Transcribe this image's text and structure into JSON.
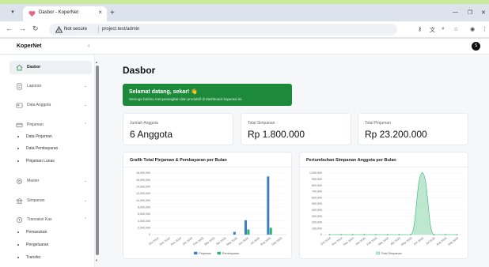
{
  "browser": {
    "tab_title": "Dasbor - KoperNet",
    "new_tab": "+",
    "not_secure": "Not secure",
    "url": "project.test/admin"
  },
  "app": {
    "brand": "KoperNet",
    "avatar_initial": "S",
    "page_title": "Dasbor"
  },
  "sidebar": {
    "items": [
      {
        "label": "Dasbor",
        "icon": "home-icon",
        "active": true
      },
      {
        "label": "Laporan",
        "icon": "report-icon"
      },
      {
        "label": "Data Anggota",
        "icon": "users-icon"
      },
      {
        "label": "Pinjaman",
        "icon": "loan-icon"
      },
      {
        "label": "Master",
        "icon": "settings-icon"
      },
      {
        "label": "Simpanan",
        "icon": "savings-icon"
      },
      {
        "label": "Transaksi Kas",
        "icon": "cash-icon"
      }
    ],
    "pinjaman_sub": [
      "Data Pinjaman",
      "Data Pembayaran",
      "Pinjaman Lunas"
    ],
    "kas_sub": [
      "Pemasukan",
      "Pengeluaran",
      "Transfer"
    ]
  },
  "welcome": {
    "title": "Selamat datang, sekar! 👋",
    "subtitle": "Semoga harimu menyenangkan dan produktif di dashboard koperasi ini."
  },
  "stats": [
    {
      "label": "Jumlah Anggota",
      "value": "6 Anggota"
    },
    {
      "label": "Total Simpanan",
      "value": "Rp 1.800.000"
    },
    {
      "label": "Total Pinjaman",
      "value": "Rp 23.200.000"
    }
  ],
  "colors": {
    "brand_green": "#1c8a3a",
    "pinjaman": "#3b7fc4",
    "pembayaran": "#2bb673",
    "simpanan": "#2bb673"
  },
  "chart_data": [
    {
      "type": "bar",
      "title": "Grafik Total Pinjaman & Pembayaran per Bulan",
      "categories": [
        "Oct 2024",
        "Nov 2024",
        "Dec 2024",
        "Jan 2025",
        "Feb 2025",
        "Mar 2025",
        "Apr 2025",
        "May 2025",
        "Jun 2025",
        "Jul 2025",
        "Aug 2025",
        "Sep 2025"
      ],
      "yticks": [
        "0",
        "2,000,000",
        "4,000,000",
        "6,000,000",
        "8,000,000",
        "10,000,000",
        "12,000,000",
        "14,000,000",
        "16,000,000",
        "18,000,000"
      ],
      "ylim": [
        0,
        18000000
      ],
      "series": [
        {
          "name": "Pinjaman",
          "values": [
            0,
            0,
            0,
            0,
            0,
            0,
            0,
            800000,
            4200000,
            0,
            17000000,
            0
          ]
        },
        {
          "name": "Pembayaran",
          "values": [
            0,
            0,
            0,
            0,
            0,
            0,
            0,
            0,
            1500000,
            0,
            2000000,
            0
          ]
        }
      ],
      "legend": "bottom"
    },
    {
      "type": "area",
      "title": "Pertumbuhan Simpanan Anggota per Bulan",
      "categories": [
        "Oct 2024",
        "Nov 2024",
        "Dec 2024",
        "Jan 2025",
        "Feb 2025",
        "Mar 2025",
        "Apr 2025",
        "May 2025",
        "Jun 2025",
        "Jul 2025",
        "Aug 2025",
        "Sep 2025"
      ],
      "yticks": [
        "0",
        "100,000",
        "200,000",
        "300,000",
        "400,000",
        "500,000",
        "600,000",
        "700,000",
        "800,000",
        "900,000",
        "1,000,000"
      ],
      "ylim": [
        0,
        1000000
      ],
      "series": [
        {
          "name": "Total Simpanan",
          "values": [
            0,
            0,
            0,
            0,
            0,
            0,
            0,
            0,
            1000000,
            0,
            0,
            0
          ]
        }
      ],
      "legend": "bottom"
    }
  ]
}
